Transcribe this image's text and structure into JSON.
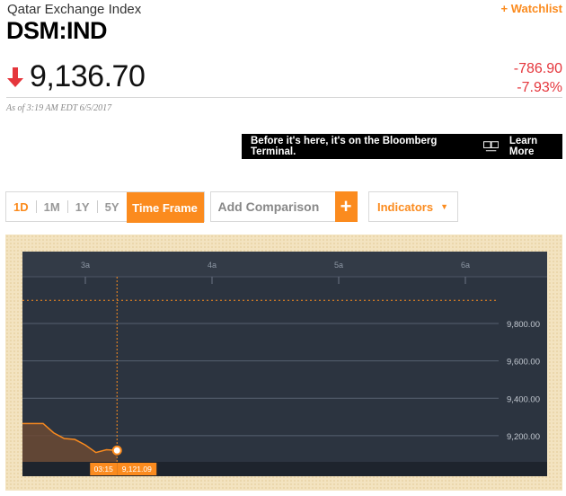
{
  "header": {
    "index_name": "Qatar Exchange Index",
    "ticker": "DSM:IND",
    "watchlist_label": "+ Watchlist"
  },
  "quote": {
    "price": "9,136.70",
    "change": "-786.90",
    "change_percent": "-7.93%",
    "direction": "down",
    "as_of": "As of 3:19 AM EDT 6/5/2017"
  },
  "banner": {
    "message": "Before it's here, it's on the Bloomberg Terminal.",
    "icon": "terminal-icon",
    "cta": "Learn More"
  },
  "controls": {
    "ranges": [
      "1D",
      "1M",
      "1Y",
      "5Y"
    ],
    "active_range": "1D",
    "time_frame_label": "Time Frame",
    "comparison_placeholder": "Add Comparison",
    "plus_label": "+",
    "indicators_label": "Indicators",
    "indicators_caret": "▼"
  },
  "colors": {
    "accent": "#fb8b1e",
    "negative": "#e5363c",
    "chart_bg": "#2c3440",
    "chart_frame": "#f3e3c0"
  },
  "chart_data": {
    "type": "area",
    "x_ticks": [
      "3a",
      "4a",
      "5a",
      "6a"
    ],
    "y_ticks": [
      "9,800.00",
      "9,600.00",
      "9,400.00",
      "9,200.00"
    ],
    "ylim": [
      9060,
      10050
    ],
    "previous_close": 9923.6,
    "series": [
      {
        "x": [
          "02:40",
          "02:45",
          "02:50",
          "02:55",
          "03:00",
          "03:05",
          "03:10",
          "03:15"
        ],
        "values": [
          9265,
          9215,
          9185,
          9180,
          9150,
          9110,
          9125,
          9121.09
        ]
      }
    ],
    "crosshair": {
      "time": "03:15",
      "value": "9,121.09"
    },
    "grid": true
  }
}
